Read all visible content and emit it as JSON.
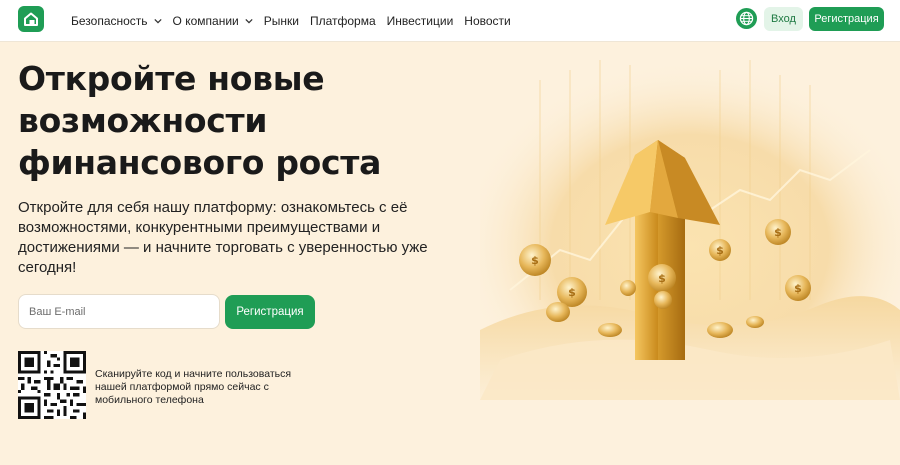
{
  "header": {
    "nav": [
      {
        "label": "Безопасность",
        "has_dropdown": true
      },
      {
        "label": "О компании",
        "has_dropdown": true
      },
      {
        "label": "Рынки",
        "has_dropdown": false
      },
      {
        "label": "Платформа",
        "has_dropdown": false
      },
      {
        "label": "Инвестиции",
        "has_dropdown": false
      },
      {
        "label": "Новости",
        "has_dropdown": false
      }
    ],
    "login_label": "Вход",
    "register_label": "Регистрация"
  },
  "hero": {
    "title": "Откройте новые возможности финансового роста",
    "subtitle": "Откройте для себя нашу платформу: ознакомьтесь с её возможностями, конкурентными преимуществами и достижениями — и начните торговать с уверенностью уже сегодня!",
    "email_placeholder": "Ваш E-mail",
    "register_label": "Регистрация",
    "qr_text": "Сканируйте код и начните пользоваться нашей платформой прямо сейчас с мобильного телефона"
  },
  "colors": {
    "brand": "#1f9d55",
    "background": "#fdf1dd",
    "login_bg": "#e3f4e8"
  },
  "icons": {
    "logo": "home-icon",
    "language": "globe-icon",
    "dropdown": "chevron-down-icon"
  }
}
